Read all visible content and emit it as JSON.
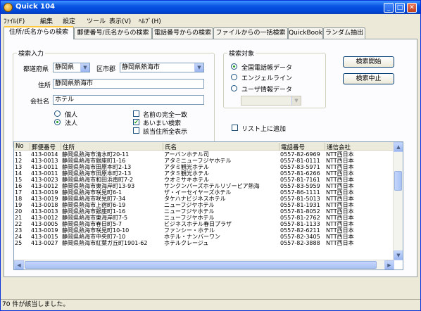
{
  "window": {
    "title": "Quick 104"
  },
  "menu": [
    {
      "label": "ﾌｧｲﾙ(F)"
    },
    {
      "label": "編集"
    },
    {
      "label": "設定"
    },
    {
      "label": "ツール"
    },
    {
      "label": "表示(V)"
    },
    {
      "label": "ﾍﾙﾌﾟ(H)"
    }
  ],
  "tabs": [
    {
      "label": "住所/氏名からの検索"
    },
    {
      "label": "郵便番号/氏名からの検索"
    },
    {
      "label": "電話番号からの検索"
    },
    {
      "label": "ファイルからの一括検索"
    },
    {
      "label": "QuickBook"
    },
    {
      "label": "ランダム抽出"
    }
  ],
  "search_input": {
    "legend": "検索入力",
    "prefecture_label": "都道府県",
    "prefecture_value": "静岡県",
    "city_label": "区市郡",
    "city_value": "静岡県熱海市",
    "address_label": "住所",
    "address_value": "静岡県熱海市",
    "company_label": "会社名",
    "company_value": "ホテル",
    "radio_individual": "個人",
    "radio_corporate": "法人",
    "chk_exact_name": "名前の完全一致",
    "chk_fuzzy": "あいまい検索",
    "chk_show_all": "該当住所全表示"
  },
  "search_target": {
    "legend": "検索対象",
    "opt1": "全国電話帳データ",
    "opt2": "エンジェルライン",
    "opt3": "ユーザ情報データ"
  },
  "buttons": {
    "start": "検索開始",
    "stop": "検索中止"
  },
  "add_to_list": "リスト上に追加",
  "table": {
    "headers": [
      "No",
      "郵便番号",
      "住所",
      "氏名",
      "電話番号",
      "通信会社"
    ],
    "rows": [
      [
        "11",
        "413-0014",
        "静岡県熱海市清水町20-11",
        "アーバンホテル司",
        "0557-82-6969",
        "NTT西日本"
      ],
      [
        "12",
        "413-0013",
        "静岡県熱海市銀座町1-16",
        "アタミニューフジヤホテル",
        "0557-81-0111",
        "NTT西日本"
      ],
      [
        "13",
        "413-0011",
        "静岡県熱海市田原本町2-13",
        "アタミ観光ホテル",
        "0557-83-5971",
        "NTT西日本"
      ],
      [
        "14",
        "413-0011",
        "静岡県熱海市田原本町2-13",
        "アタミ観光ホテル",
        "0557-81-6266",
        "NTT西日本"
      ],
      [
        "15",
        "413-0023",
        "静岡県熱海市和田浜南町7-2",
        "ウオミサキホテル",
        "0557-81-7161",
        "NTT西日本"
      ],
      [
        "16",
        "413-0012",
        "静岡県熱海市東海岸町13-93",
        "サンクンパーズホテルリゾーピア熱海",
        "0557-83-5959",
        "NTT西日本"
      ],
      [
        "17",
        "413-0019",
        "静岡県熱海市咲見町6-1",
        "ザ・イーセイヤーズホテル",
        "0557-86-1111",
        "NTT西日本"
      ],
      [
        "18",
        "413-0019",
        "静岡県熱海市咲見町7-34",
        "タケハナビジネスホテル",
        "0557-81-5013",
        "NTT西日本"
      ],
      [
        "19",
        "413-0018",
        "静岡県熱海市上宿町6-19",
        "ニューフジヤホテル",
        "0557-81-1931",
        "NTT西日本"
      ],
      [
        "20",
        "413-0013",
        "静岡県熱海市銀座町1-16",
        "ニューフジヤホテル",
        "0557-81-8052",
        "NTT西日本"
      ],
      [
        "21",
        "413-0012",
        "静岡県熱海市東海岸町7-5",
        "ニューフジヤホテル",
        "0557-81-2762",
        "NTT西日本"
      ],
      [
        "22",
        "413-0005",
        "静岡県熱海市春日町5-7",
        "ビジネスホテル春日プラザ",
        "0557-81-1133",
        "NTT西日本"
      ],
      [
        "23",
        "413-0019",
        "静岡県熱海市咲見町10-10",
        "ファンシー・ホテル",
        "0557-82-6211",
        "NTT西日本"
      ],
      [
        "24",
        "413-0015",
        "静岡県熱海市中央町7-10",
        "ホテル・ナンバーワン",
        "0557-82-3405",
        "NTT西日本"
      ],
      [
        "25",
        "413-0027",
        "静岡県熱海市紅葉ガ丘町1901-62",
        "ホテルクレージュ",
        "0557-82-3888",
        "NTT西日本"
      ]
    ]
  },
  "status": "70 件が該当しました。"
}
